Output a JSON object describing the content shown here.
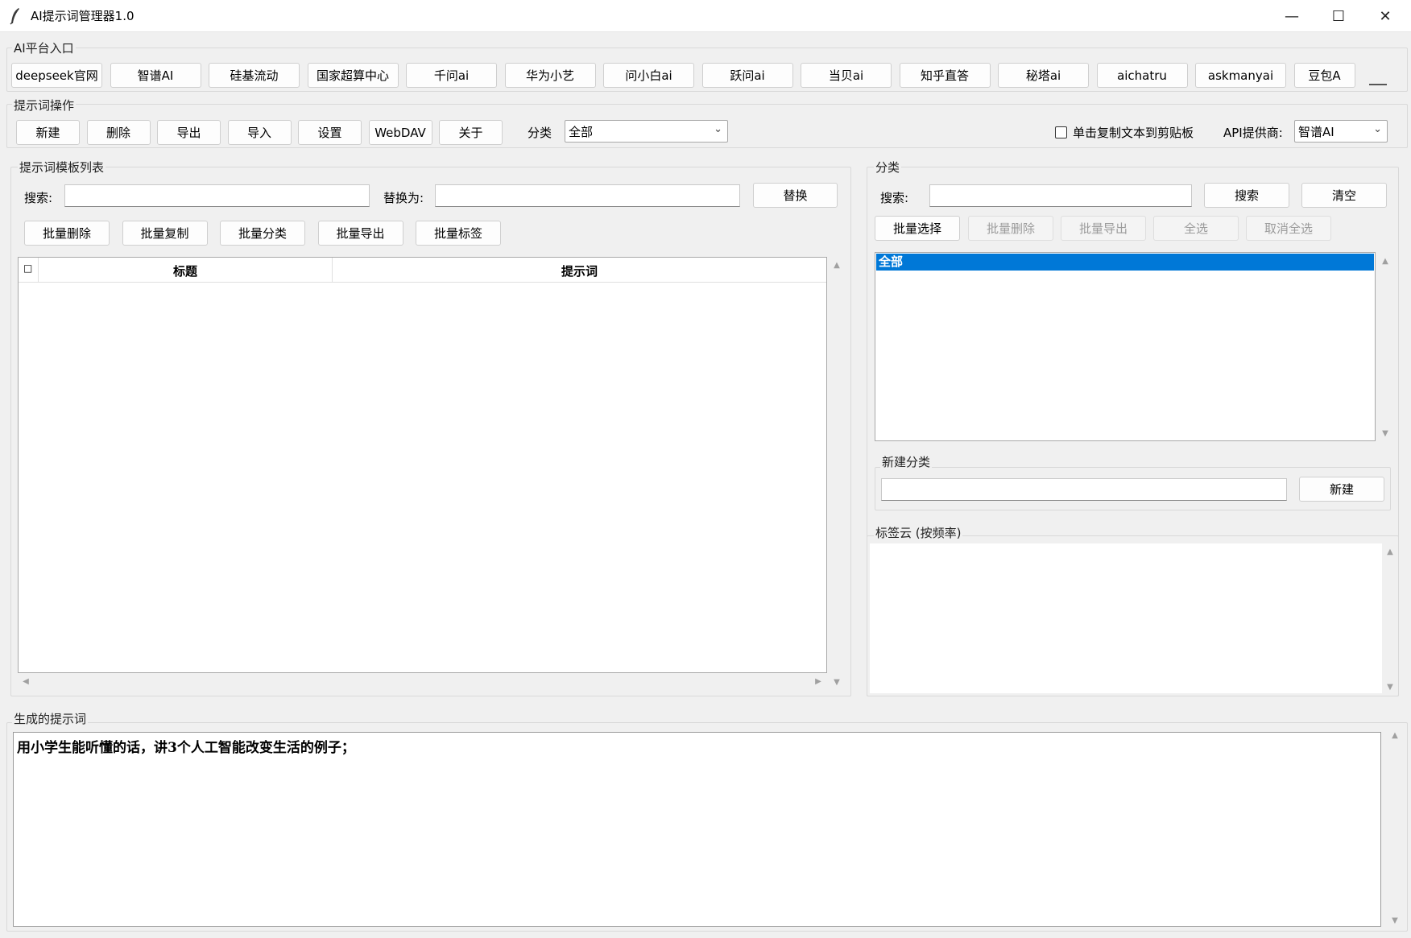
{
  "window": {
    "title": "AI提示词管理器1.0",
    "controls": {
      "minimize": "—",
      "maximize": "☐",
      "close": "✕"
    }
  },
  "platform": {
    "group_label": "AI平台入口",
    "buttons": [
      "deepseek官网",
      "智谱AI",
      "硅基流动",
      "国家超算中心",
      "千问ai",
      "华为小艺",
      "问小白ai",
      "跃问ai",
      "当贝ai",
      "知乎直答",
      "秘塔ai",
      "aichatru",
      "askmanyai",
      "豆包A"
    ]
  },
  "ops": {
    "group_label": "提示词操作",
    "buttons": [
      "新建",
      "删除",
      "导出",
      "导入",
      "设置",
      "WebDAV",
      "关于"
    ],
    "category_label": "分类",
    "category_value": "全部",
    "copy_checkbox_label": "单击复制文本到剪贴板",
    "copy_checked": false,
    "api_label": "API提供商:",
    "api_value": "智谱AI"
  },
  "templates": {
    "group_label": "提示词模板列表",
    "search_label": "搜索:",
    "search_value": "",
    "replace_label": "替换为:",
    "replace_value": "",
    "replace_button": "替换",
    "batch_buttons": [
      "批量删除",
      "批量复制",
      "批量分类",
      "批量导出",
      "批量标签"
    ],
    "table": {
      "check_header": "□",
      "columns": [
        "标题",
        "提示词"
      ],
      "rows": []
    }
  },
  "category_panel": {
    "group_label": "分类",
    "search_label": "搜索:",
    "search_value": "",
    "search_button": "搜索",
    "clear_button": "清空",
    "batch_select_button": "批量选择",
    "disabled_buttons": [
      "批量删除",
      "批量导出",
      "全选",
      "取消全选"
    ],
    "items": [
      "全部"
    ],
    "selected_index": 0
  },
  "new_category": {
    "group_label": "新建分类",
    "input_value": "",
    "button": "新建"
  },
  "tag_cloud": {
    "group_label": "标签云 (按频率)"
  },
  "generated": {
    "group_label": "生成的提示词",
    "text": "用小学生能听懂的话，讲3个人工智能改变生活的例子；"
  },
  "colors": {
    "selection": "#0078d7",
    "window_bg": "#f0f0f0"
  }
}
